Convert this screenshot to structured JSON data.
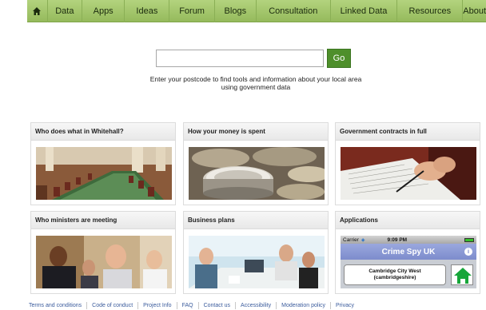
{
  "nav": {
    "items": [
      {
        "label": "Data"
      },
      {
        "label": "Apps"
      },
      {
        "label": "Ideas"
      },
      {
        "label": "Forum"
      },
      {
        "label": "Blogs"
      },
      {
        "label": "Consultation"
      },
      {
        "label": "Linked Data"
      },
      {
        "label": "Resources"
      },
      {
        "label": "About"
      }
    ]
  },
  "search": {
    "value": "",
    "placeholder": "",
    "button_label": "Go",
    "help_text": "Enter your postcode to find tools and information about your local area using government data"
  },
  "cards": [
    {
      "title": "Who does what in Whitehall?"
    },
    {
      "title": "How your money is spent"
    },
    {
      "title": "Government contracts in full"
    },
    {
      "title": "Who ministers are meeting"
    },
    {
      "title": "Business plans"
    },
    {
      "title": "Applications"
    }
  ],
  "app_preview": {
    "carrier": "Carrier",
    "time": "9:09 PM",
    "app_title": "Crime Spy UK",
    "location_line1": "Cambridge City West",
    "location_line2": "(cambridgeshire)"
  },
  "footer": {
    "links": [
      {
        "label": "Terms and conditions"
      },
      {
        "label": "Code of conduct"
      },
      {
        "label": "Project Info"
      },
      {
        "label": "FAQ"
      },
      {
        "label": "Contact us"
      },
      {
        "label": "Accessibility"
      },
      {
        "label": "Moderation policy"
      },
      {
        "label": "Privacy"
      }
    ]
  },
  "colors": {
    "nav_green": "#a6c86d",
    "go_green": "#4e8f2b",
    "link_blue": "#3a5b9c"
  }
}
